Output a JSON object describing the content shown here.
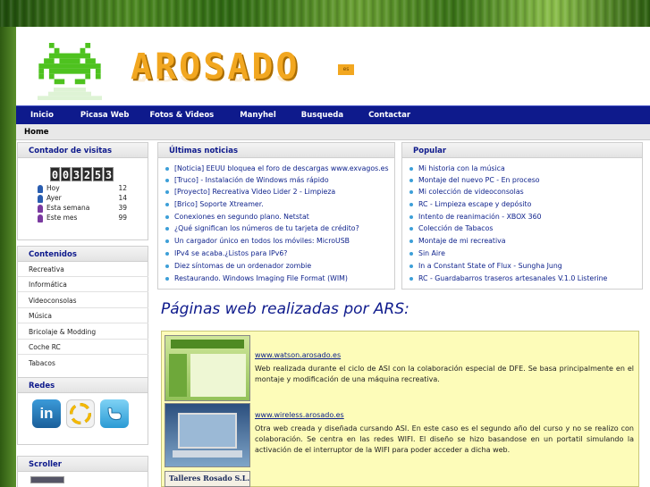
{
  "logo": {
    "text": "AROSADO",
    "tld": "es"
  },
  "nav": {
    "items": [
      "Inicio",
      "Picasa Web",
      "Fotos & Videos",
      "Manyhel",
      "Busqueda",
      "Contactar"
    ]
  },
  "breadcrumb": "Home",
  "counter": {
    "title": "Contador de visitas",
    "digits": [
      "0",
      "0",
      "3",
      "2",
      "5",
      "3"
    ],
    "rows": [
      {
        "label": "Hoy",
        "value": "12",
        "color": "#2a5db0"
      },
      {
        "label": "Ayer",
        "value": "14",
        "color": "#2a5db0"
      },
      {
        "label": "Esta semana",
        "value": "39",
        "color": "#7a3aa0"
      },
      {
        "label": "Este mes",
        "value": "99",
        "color": "#7a3aa0"
      }
    ]
  },
  "contenidos": {
    "title": "Contenidos",
    "items": [
      "Recreativa",
      "Informática",
      "Videoconsolas",
      "Música",
      "Bricolaje & Modding",
      "Coche RC",
      "Tabacos"
    ]
  },
  "redes": {
    "title": "Redes",
    "icons": [
      "linkedin-icon",
      "picasa-icon",
      "twitter-icon"
    ],
    "linkedin_text": "in"
  },
  "scroller": {
    "title": "Scroller"
  },
  "news": {
    "title": "Últimas noticias",
    "items": [
      "[Noticia] EEUU bloquea el foro de descargas www.exvagos.es",
      "[Truco] - Instalación de Windows más rápido",
      "[Proyecto] Recreativa Video Lider 2 - Limpieza",
      "[Brico] Soporte Xtreamer.",
      "Conexiones en segundo plano. Netstat",
      "¿Qué significan los números de tu tarjeta de crédito?",
      "Un cargador único en todos los móviles: MicroUSB",
      "IPv4 se acaba.¿Listos para IPv6?",
      "Diez síntomas de un ordenador zombie",
      "Restaurando. Windows Imaging File Format (WIM)"
    ]
  },
  "popular": {
    "title": "Popular",
    "items": [
      "Mi historia con la música",
      "Montaje del nuevo PC - En proceso",
      "Mi colección de videoconsolas",
      "RC - Limpieza escape y depósito",
      "Intento de reanimación - XBOX 360",
      "Colección de Tabacos",
      "Montaje de mi recreativa",
      "Sin Aire",
      "In a Constant State of Flux - Sungha Jung",
      "RC - Guardabarros traseros artesanales V.1.0 Listerine"
    ]
  },
  "sites_title": "Páginas web realizadas por ARS:",
  "sites": [
    {
      "url": "www.watson.arosado.es",
      "desc": "Web realizada durante el ciclo de ASI con la colaboración especial de DFE. Se basa principalmente en el montaje y modificación de una máquina recreativa."
    },
    {
      "url": "www.wireless.arosado.es",
      "desc": "Otra web creada y diseñada cursando ASI. En este caso es el segundo año del curso y no se realizo con colaboración. Se centra en las redes WIFI. El diseño se hizo basandose en un portatil simulando la activación de el interruptor de la WIFI para poder acceder a dicha web."
    },
    {
      "thumb_text": "Talleres Rosado S.L."
    }
  ],
  "colors": {
    "nav_bg": "#0e1a8c",
    "logo": "#f2a720",
    "invader": "#4ec21f",
    "showcase_bg": "#fdfcb9"
  }
}
